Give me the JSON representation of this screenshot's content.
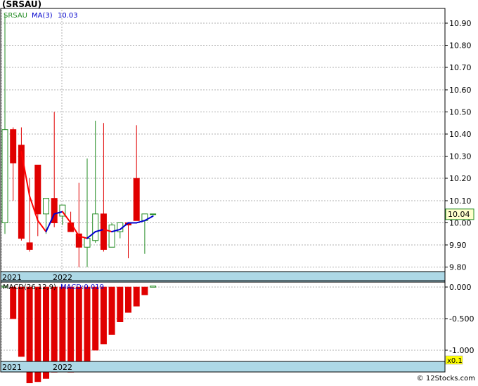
{
  "chart_data": [
    {
      "type": "candlestick",
      "title": "(SRSAU)",
      "legend": {
        "symbol": "SRSAU",
        "ma_label": "MA(3)",
        "ma_value": "10.03"
      },
      "x_labels": [
        "2021",
        "2022"
      ],
      "ylim": [
        9.78,
        10.96
      ],
      "y_ticks": [
        9.8,
        9.9,
        10.0,
        10.1,
        10.2,
        10.3,
        10.4,
        10.5,
        10.6,
        10.7,
        10.8,
        10.9
      ],
      "y_tick_labels": [
        "9.80",
        "9.90",
        "10.00",
        "10.10",
        "10.20",
        "10.30",
        "10.40",
        "10.50",
        "10.60",
        "10.70",
        "10.80",
        "10.90"
      ],
      "last_price_label": "10.04",
      "grid": true,
      "candles": [
        {
          "open": 10.0,
          "high": 10.94,
          "low": 9.95,
          "close": 10.42
        },
        {
          "open": 10.42,
          "high": 10.43,
          "low": 10.1,
          "close": 10.27
        },
        {
          "open": 10.35,
          "high": 10.43,
          "low": 9.92,
          "close": 9.93
        },
        {
          "open": 9.91,
          "high": 10.2,
          "low": 9.87,
          "close": 9.88
        },
        {
          "open": 10.26,
          "high": 10.26,
          "low": 9.94,
          "close": 10.04
        },
        {
          "open": 10.04,
          "high": 10.11,
          "low": 9.95,
          "close": 10.11
        },
        {
          "open": 10.11,
          "high": 10.5,
          "low": 9.98,
          "close": 10.0
        },
        {
          "open": 10.03,
          "high": 10.08,
          "low": 9.99,
          "close": 10.08
        },
        {
          "open": 10.0,
          "high": 10.05,
          "low": 9.96,
          "close": 9.96
        },
        {
          "open": 9.95,
          "high": 10.18,
          "low": 9.8,
          "close": 9.89
        },
        {
          "open": 9.89,
          "high": 10.29,
          "low": 9.8,
          "close": 9.93
        },
        {
          "open": 9.92,
          "high": 10.46,
          "low": 9.91,
          "close": 10.04
        },
        {
          "open": 10.04,
          "high": 10.45,
          "low": 9.87,
          "close": 9.88
        },
        {
          "open": 9.89,
          "high": 10.0,
          "low": 9.89,
          "close": 9.99
        },
        {
          "open": 9.96,
          "high": 10.0,
          "low": 9.93,
          "close": 10.0
        },
        {
          "open": 10.0,
          "high": 10.0,
          "low": 9.84,
          "close": 9.99
        },
        {
          "open": 10.2,
          "high": 10.44,
          "low": 10.01,
          "close": 10.01
        },
        {
          "open": 10.01,
          "high": 10.04,
          "low": 9.86,
          "close": 10.04
        },
        {
          "open": 10.04,
          "high": 10.04,
          "low": 10.04,
          "close": 10.04
        }
      ],
      "ma_values": [
        null,
        null,
        10.32,
        10.12,
        10.01,
        9.96,
        10.04,
        10.05,
        10.0,
        9.94,
        9.93,
        9.96,
        9.97,
        9.96,
        9.97,
        10.0,
        10.0,
        10.01,
        10.03
      ]
    },
    {
      "type": "bar",
      "title": "MACD(26,12,9)",
      "legend": {
        "name": "MACD(26,12,9)",
        "value_label": "MACD:0.019"
      },
      "x_labels": [
        "2021",
        "2022"
      ],
      "ylim": [
        -1.18,
        0.08
      ],
      "y_ticks": [
        0.0,
        -0.5,
        -1.0
      ],
      "y_tick_labels": [
        "0.000",
        "-0.500",
        "-1.000"
      ],
      "scale_badge": "x0.1",
      "values": [
        0.019,
        -0.5,
        -1.1,
        -1.6,
        -1.5,
        -1.45,
        -1.35,
        -1.3,
        -1.35,
        -1.3,
        -1.2,
        -1.0,
        -0.9,
        -0.75,
        -0.55,
        -0.4,
        -0.3,
        -0.12,
        0.019
      ]
    }
  ],
  "footer": {
    "copyright": "© 12Stocks.com"
  },
  "colors": {
    "up": "#228B22",
    "down": "#e00000",
    "ma_up": "#0000cc",
    "ma_down": "#ff0000",
    "axis_band": "#add8e6",
    "price_box": "#ffffcc",
    "badge": "#ffff00",
    "legend_symbol": "#228B22",
    "legend_ma": "#0000cc"
  }
}
